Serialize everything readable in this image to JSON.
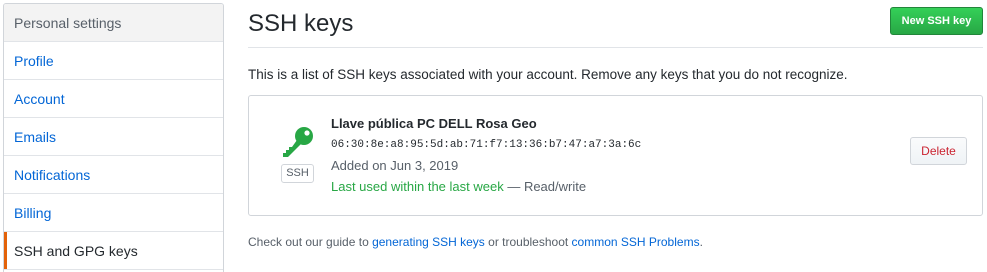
{
  "sidebar": {
    "header": "Personal settings",
    "items": [
      {
        "label": "Profile"
      },
      {
        "label": "Account"
      },
      {
        "label": "Emails"
      },
      {
        "label": "Notifications"
      },
      {
        "label": "Billing"
      },
      {
        "label": "SSH and GPG keys",
        "selected": true
      }
    ]
  },
  "main": {
    "title": "SSH keys",
    "new_key_label": "New SSH key",
    "description": "This is a list of SSH keys associated with your account. Remove any keys that you do not recognize.",
    "key": {
      "icon": "key-icon",
      "type_label": "SSH",
      "title": "Llave pública PC DELL Rosa Geo",
      "fingerprint": "06:30:8e:a8:95:5d:ab:71:f7:13:36:b7:47:a7:3a:6c",
      "added": "Added on Jun 3, 2019",
      "last_used": "Last used within the last week",
      "access": " — Read/write",
      "delete_label": "Delete"
    },
    "footer": {
      "prefix": "Check out our guide to ",
      "link1": "generating SSH keys",
      "middle": " or troubleshoot ",
      "link2": "common SSH Problems",
      "suffix": "."
    }
  },
  "colors": {
    "accent_green": "#28a745",
    "key_icon": "#28a745",
    "link": "#0366d6",
    "danger": "#cb2431",
    "selected_marker": "#e36209"
  }
}
